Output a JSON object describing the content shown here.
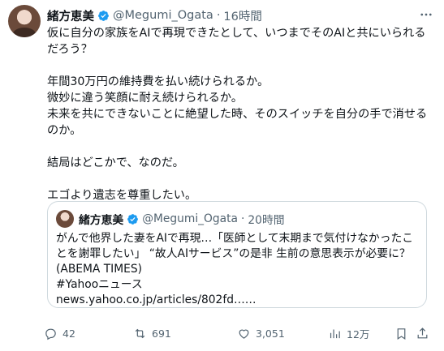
{
  "author": {
    "name": "緒方恵美",
    "handle": "@Megumi_Ogata",
    "separator": "·",
    "time": "16時間"
  },
  "tweet": {
    "text": "仮に自分の家族をAIで再現できたとして、いつまでそのAIと共にいられるだろう？\n\n年間30万円の維持費を払い続けられるか。\n微妙に違う笑顔に耐え続けられるか。\n未来を共にできないことに絶望した時、そのスイッチを自分の手で消せるのか。\n\n結局はどこかで、なのだ。\n\nエゴより遺志を尊重したい。"
  },
  "quote": {
    "name": "緒方恵美",
    "handle": "@Megumi_Ogata",
    "separator": "·",
    "time": "20時間",
    "text": "がんで他界した妻をAIで再現…「医師として末期まで気付けなかったことを謝罪したい」 “故人AIサービス”の是非 生前の意思表示が必要に？ (ABEMA TIMES)\n#Yahooニュース\nnews.yahoo.co.jp/articles/802fd……"
  },
  "actions": {
    "replies": "42",
    "reposts": "691",
    "likes": "3,051",
    "views": "12万"
  },
  "colors": {
    "verified": "#1d9bf0",
    "muted": "#536471",
    "border": "#cfd9de"
  },
  "icons": [
    "verified-badge-icon",
    "more-icon",
    "reply-icon",
    "repost-icon",
    "like-icon",
    "views-icon",
    "bookmark-icon",
    "share-icon"
  ]
}
